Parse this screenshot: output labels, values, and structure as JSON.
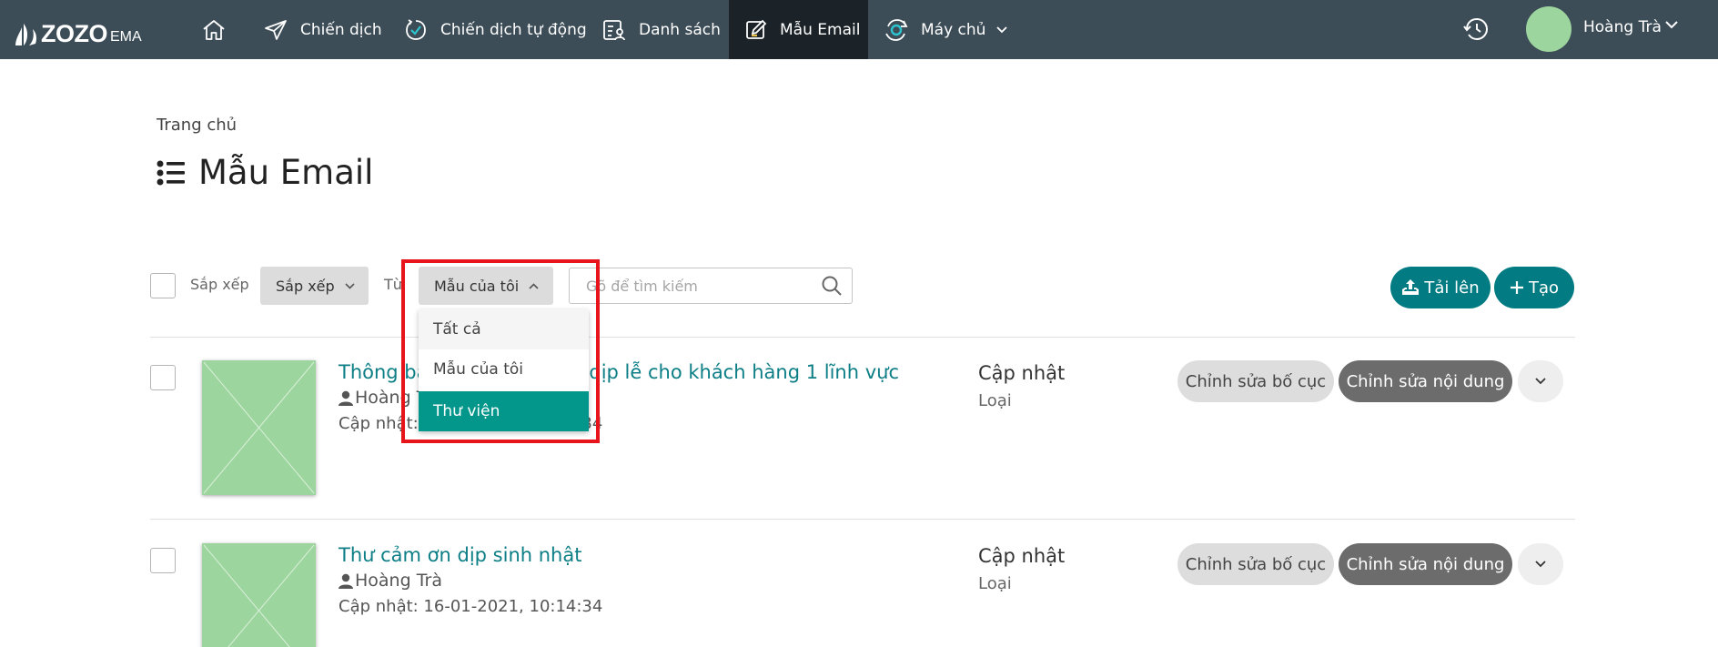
{
  "brand": {
    "logo_main": "ZOZO",
    "logo_sub": "EMA"
  },
  "nav": {
    "items": [
      {
        "label": "Chiến dịch",
        "icon": "send-icon"
      },
      {
        "label": "Chiến dịch tự động",
        "icon": "auto-check-icon"
      },
      {
        "label": "Danh sách",
        "icon": "contact-list-icon"
      },
      {
        "label": "Mẫu Email",
        "icon": "edit-template-icon",
        "active": true
      },
      {
        "label": "Máy chủ",
        "icon": "server-icon"
      }
    ],
    "user_name": "Hoàng Trà"
  },
  "page": {
    "breadcrumb": "Trang chủ",
    "title": "Mẫu Email"
  },
  "toolbar": {
    "sort_label": "Sắp xếp",
    "sort_button": "Sắp xếp",
    "from_label": "Từ",
    "source_button": "Mẫu của tôi",
    "search_placeholder": "Gõ để tìm kiếm",
    "upload_button": "Tải lên",
    "create_button": "Tạo"
  },
  "dropdown": {
    "options": [
      "Tất cả",
      "Mẫu của tôi",
      "Thư viện"
    ],
    "highlighted": "Thư viện"
  },
  "templates": [
    {
      "title": "Thông báo giảm giá nhân dịp lễ cho khách hàng 1 lĩnh vực",
      "author": "Hoàng Trà",
      "updated": "Cập nhật: 16-01-2021, 10:14:34",
      "status": "Cập nhật",
      "type": "Loại",
      "edit_layout": "Chỉnh sửa bố cục",
      "edit_content": "Chỉnh sửa nội dung"
    },
    {
      "title": "Thư cảm ơn dịp sinh nhật",
      "author": "Hoàng Trà",
      "updated": "Cập nhật: 16-01-2021, 10:14:34",
      "status": "Cập nhật",
      "type": "Loại",
      "edit_layout": "Chỉnh sửa bố cục",
      "edit_content": "Chỉnh sửa nội dung"
    }
  ],
  "colors": {
    "topbar": "#3c4d58",
    "accent": "#037b83",
    "dropdown_selected": "#03968b",
    "highlight": "#e8141b",
    "thumbnail": "#9dd59f"
  }
}
